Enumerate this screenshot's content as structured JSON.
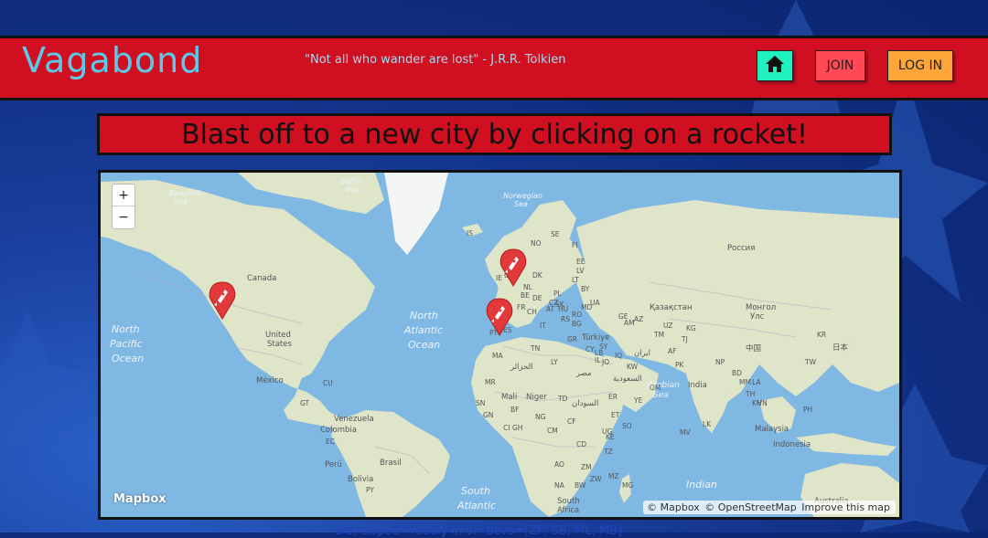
{
  "header": {
    "logo": "Vagabond",
    "quote": "\"Not all who wander are lost\" - J.R.R. Tolkien",
    "join_label": "JOIN",
    "login_label": "LOG IN"
  },
  "banner": {
    "text": "Blast off to a new city by clicking on a rocket!"
  },
  "map": {
    "zoom_in": "+",
    "zoom_out": "−",
    "logo": "Mapbox",
    "attribution": {
      "mapbox": "© Mapbox",
      "osm": "© OpenStreetMap",
      "improve": "Improve this map"
    },
    "labels": {
      "north_pacific": [
        "North",
        "Pacific",
        "Ocean"
      ],
      "north_atlantic": [
        "North",
        "Atlantic",
        "Ocean"
      ],
      "south_atlantic": [
        "South",
        "Atlantic"
      ],
      "indian": [
        "Indian"
      ],
      "arabian_sea": [
        "Arabian",
        "Sea"
      ],
      "canada": "Canada",
      "united_states": [
        "United",
        "States"
      ],
      "mexico": "México",
      "venezuela": "Venezuela",
      "colombia": "Colombia",
      "brasil": "Brasil",
      "peru": "Perú",
      "bolivia": "Bolivia",
      "russia": "Россия",
      "kazakhstan": "Қазақстан",
      "mongolia": [
        "Монгол",
        "Улс"
      ],
      "china": "中国",
      "india": "India",
      "japan": "日本",
      "turkiye": "Türkiye",
      "malaysia": "Malaysia",
      "indonesia": "Indonesia",
      "australia": "Australia",
      "south_africa": [
        "South",
        "Africa"
      ],
      "mali": "Mali",
      "niger": "Niger",
      "algeria": "الجزائر",
      "egypt": "مصر",
      "saudi": "السعودية",
      "sudan": "السودان",
      "iran": "ایران",
      "beaufort": [
        "Beaufort",
        "Sea"
      ],
      "baffin": [
        "Baffin",
        "Bay"
      ],
      "norwegian": [
        "Norwegian",
        "Sea"
      ],
      "iso": [
        "IS",
        "SE",
        "FI",
        "NO",
        "DK",
        "EE",
        "LV",
        "LT",
        "BY",
        "PL",
        "UA",
        "DE",
        "CZ",
        "FR",
        "IT",
        "ES",
        "PT",
        "GR",
        "TN",
        "MA",
        "LY",
        "SY",
        "IQ",
        "JO",
        "KW",
        "AF",
        "PK",
        "TM",
        "UZ",
        "KG",
        "TJ",
        "NP",
        "BD",
        "MM",
        "LA",
        "TH",
        "VN",
        "KH",
        "PH",
        "LK",
        "MV",
        "OM",
        "YE",
        "ER",
        "ET",
        "SO",
        "KE",
        "TZ",
        "CD",
        "CM",
        "NG",
        "GH",
        "CI",
        "BF",
        "SN",
        "GN",
        "MR",
        "CF",
        "TD",
        "UG",
        "AO",
        "ZM",
        "MZ",
        "NA",
        "BW",
        "MG",
        "ZW",
        "CU",
        "GT",
        "EC",
        "PY",
        "TW",
        "KR",
        "GE",
        "AM",
        "AZ",
        "IL",
        "LB",
        "CY",
        "HU",
        "RO",
        "BG",
        "RS",
        "MD",
        "SK",
        "AT",
        "CH",
        "BE",
        "NL",
        "GB",
        "IE"
      ]
    }
  },
  "footer": {
    "text": "Developed Proudly in SF. devs=[ZF, SB, ML, MB]"
  },
  "colors": {
    "header_red": "#d01020",
    "logo_blue": "#5ec8e8",
    "home_green": "#21f0bf",
    "join_red": "#ff4a55",
    "login_orange": "#ffa63a",
    "ocean": "#7fb8e3",
    "land": "#dfe5c8",
    "pin": "#e23a3a"
  },
  "icons": {
    "home": "home-icon",
    "pins": [
      "rocket-pin-icon",
      "rocket-pin-icon",
      "rocket-pin-icon"
    ]
  }
}
